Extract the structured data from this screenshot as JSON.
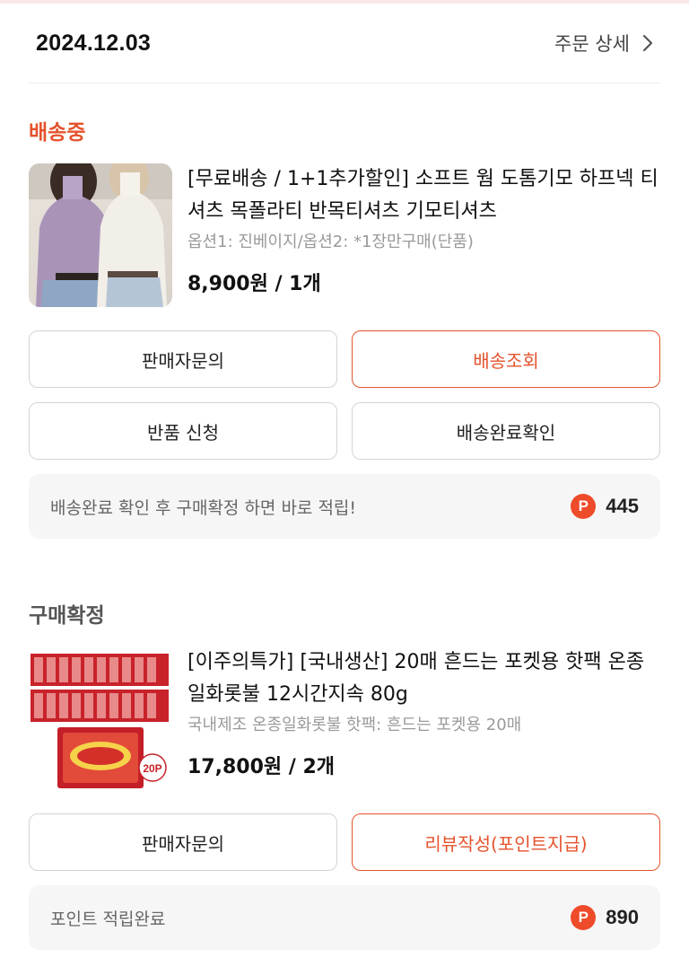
{
  "header": {
    "date": "2024.12.03",
    "order_detail_label": "주문 상세"
  },
  "orders": [
    {
      "status": "배송중",
      "product": {
        "title": "[무료배송 / 1+1추가할인] 소프트 웜 도톰기모 하프넥 티셔츠 목폴라티 반목티셔츠 기모티셔츠",
        "option": "옵션1: 진베이지/옵션2: *1장만구매(단품)",
        "price": "8,900원 / 1개"
      },
      "buttons": [
        "판매자문의",
        "배송조회",
        "반품 신청",
        "배송완료확인"
      ],
      "info": {
        "text": "배송완료 확인 후 구매확정 하면 바로 적립!",
        "badge": "P",
        "points": "445"
      }
    },
    {
      "status": "구매확정",
      "product": {
        "title": "[이주의특가] [국내생산] 20매 흔드는 포켓용 핫팩 온종일화롯불 12시간지속 80g",
        "option": "국내제조 온종일화롯불 핫팩: 흔드는 포켓용 20매",
        "price": "17,800원 / 2개",
        "thumb_label": "20P"
      },
      "buttons": [
        "판매자문의",
        "리뷰작성(포인트지급)"
      ],
      "info": {
        "text": "포인트 적립완료",
        "badge": "P",
        "points": "890"
      }
    }
  ],
  "colors": {
    "accent": "#e5532d",
    "point_badge": "#ee4b2b",
    "info_bg": "#f6f6f6"
  }
}
